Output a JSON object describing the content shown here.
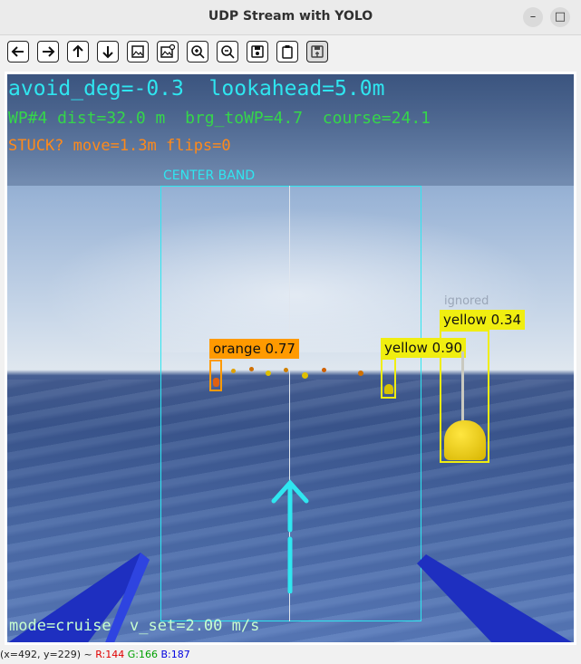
{
  "window": {
    "title": "UDP Stream with YOLO",
    "minimize_glyph": "–",
    "maximize_glyph": "□",
    "close_glyph": "✕"
  },
  "toolbar": {
    "icons": [
      "arrow-left-icon",
      "arrow-right-icon",
      "arrow-up-icon",
      "arrow-down-icon",
      "image-icon",
      "image-edit-icon",
      "zoom-in-icon",
      "zoom-out-icon",
      "save-icon",
      "clipboard-icon",
      "save-as-icon"
    ]
  },
  "hud": {
    "line1": "avoid_deg=-0.3  lookahead=5.0m",
    "line2": "WP#4 dist=32.0 m  brg_toWP=4.7  course=24.1",
    "line3": "STUCK? move=1.3m flips=0",
    "center_band": "CENTER BAND",
    "mode_line": "mode=cruise  v_set=2.00 m/s",
    "colors": {
      "cyan": "#2fe6f0",
      "green": "#35d64a",
      "orange": "#ff8a1a",
      "white_green": "#c8ffd0"
    }
  },
  "detections": [
    {
      "label": "orange 0.77",
      "color": "#ff9a00",
      "class": "orange"
    },
    {
      "label": "yellow 0.90",
      "color": "#f0ee10",
      "class": "yellow"
    },
    {
      "label": "yellow 0.34",
      "color": "#f0ee10",
      "class": "yellow",
      "note": "ignored"
    }
  ],
  "status": {
    "coords": "(x=492, y=229) ~ ",
    "r": "R:144",
    "g": "G:166",
    "b": "B:187",
    "r_color": "#e00000",
    "g_color": "#00a000",
    "b_color": "#0000e0"
  }
}
